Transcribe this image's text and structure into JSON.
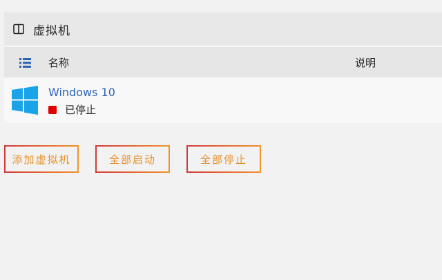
{
  "panel": {
    "title": "虚拟机",
    "columns": {
      "name": "名称",
      "description": "说明"
    }
  },
  "vms": [
    {
      "name": "Windows 10",
      "status": "已停止",
      "status_color": "#e00000",
      "os_icon": "windows-logo-icon"
    }
  ],
  "actions": {
    "add_label": "添加虚拟机",
    "start_all_label": "全部启动",
    "stop_all_label": "全部停止"
  },
  "colors": {
    "link": "#2b63b8",
    "button_text": "#e8902a",
    "button_border_start": "#d23a3a",
    "button_border_end": "#f0932a",
    "windows_blue": "#1aa3e8"
  }
}
